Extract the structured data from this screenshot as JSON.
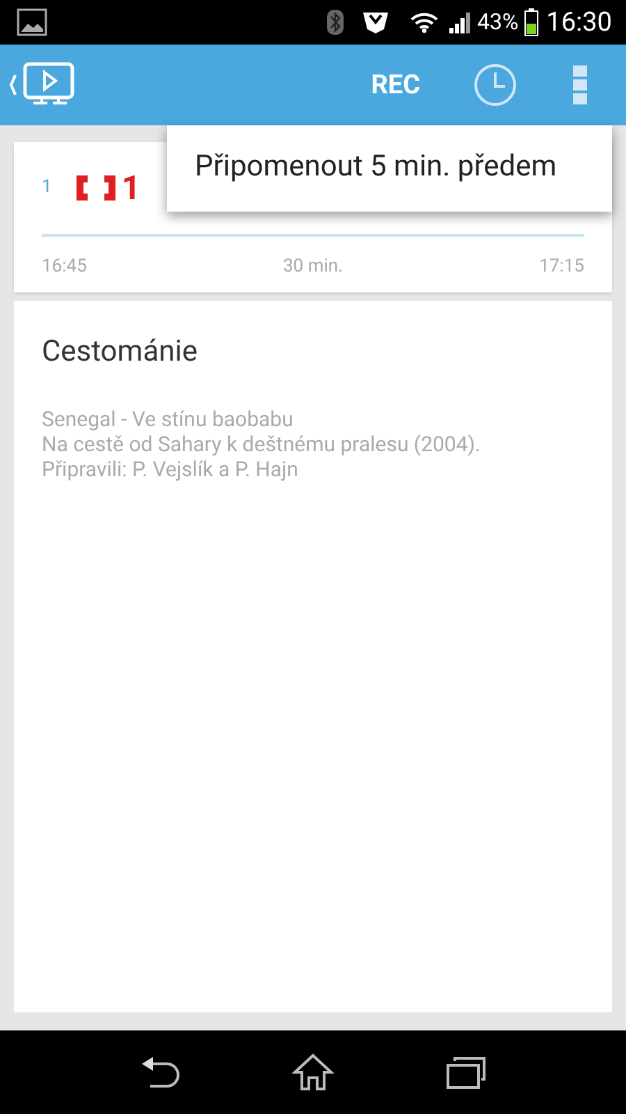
{
  "status_bar": {
    "battery": "43%",
    "time": "16:30"
  },
  "app_bar": {
    "title": "REC"
  },
  "channel_card": {
    "number": "1",
    "logo_text": "1",
    "start": "16:45",
    "duration": "30 min.",
    "end": "17:15"
  },
  "program": {
    "title": "Cestománie",
    "description": [
      "Senegal - Ve stínu baobabu",
      "Na cestě od Sahary k deštnému pralesu (2004).",
      "Připravili: P. Vejslík a P. Hajn"
    ]
  },
  "popup_menu": {
    "items": [
      "Připomenout 5 min. předem"
    ]
  }
}
